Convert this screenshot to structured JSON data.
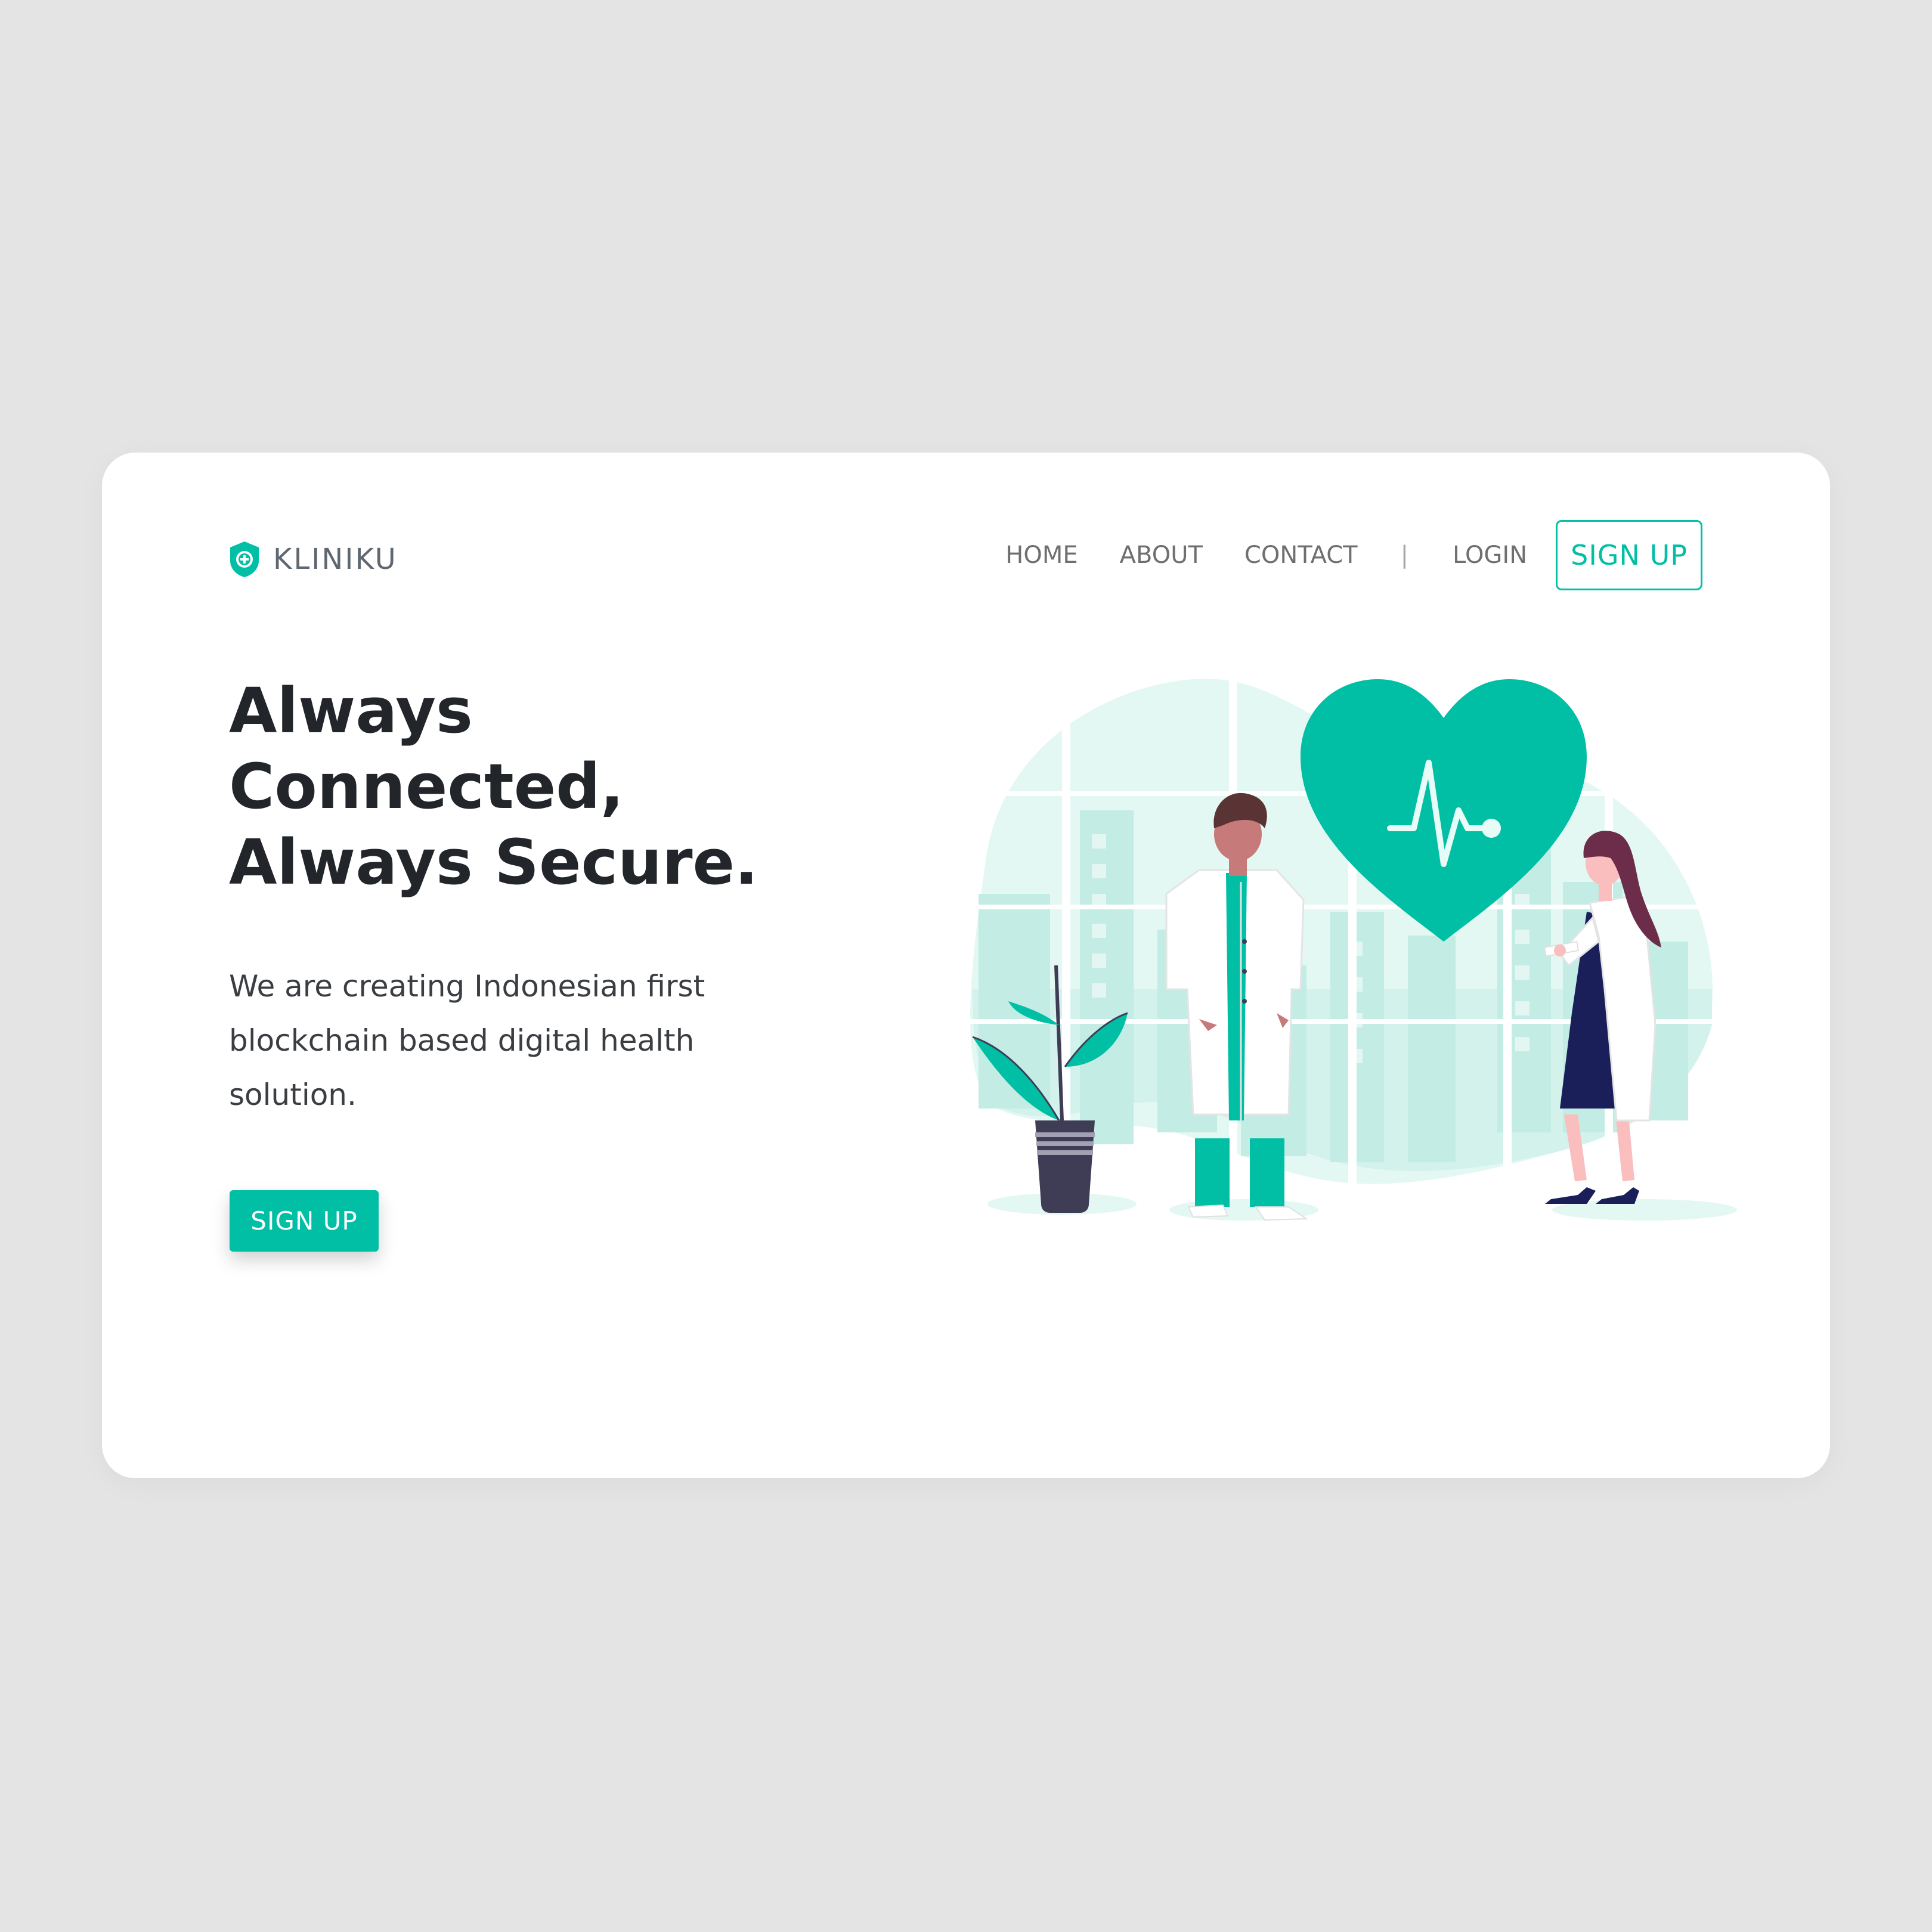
{
  "brand": {
    "name": "KLINIKU",
    "logo_icon": "shield-plus-icon",
    "accent_color": "#00bfa5"
  },
  "nav": {
    "items": [
      "HOME",
      "ABOUT",
      "CONTACT"
    ],
    "divider": "|",
    "login": "LOGIN",
    "signup": "SIGN UP"
  },
  "hero": {
    "title_lines": [
      "Always",
      "Connected,",
      "Always Secure."
    ],
    "subtitle_lines": [
      "We are creating Indonesian first",
      "blockchain based digital health",
      "solution."
    ],
    "cta": "SIGN UP"
  },
  "illustration": {
    "icon": "doctors-heart-illustration"
  }
}
